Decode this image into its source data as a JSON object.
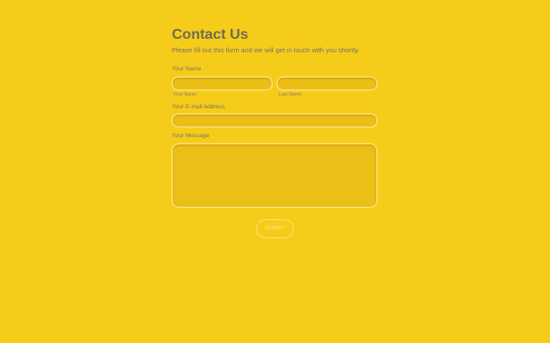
{
  "form": {
    "title": "Contact Us",
    "subtitle": "Please fill out this form and we will get in touch with you shortly.",
    "name_label": "Your Name",
    "first_name": {
      "label": "First Name",
      "value": ""
    },
    "last_name": {
      "label": "Last Name",
      "value": ""
    },
    "email": {
      "label": "Your E-mail Address",
      "value": ""
    },
    "message": {
      "label": "Your Message",
      "value": ""
    },
    "submit_label": "SUBMIT"
  },
  "colors": {
    "background": "#f6cc1a",
    "field_fill": "#ecbf17",
    "field_border": "#fbe27a",
    "text": "#7a7461",
    "title": "#6e6a55"
  }
}
